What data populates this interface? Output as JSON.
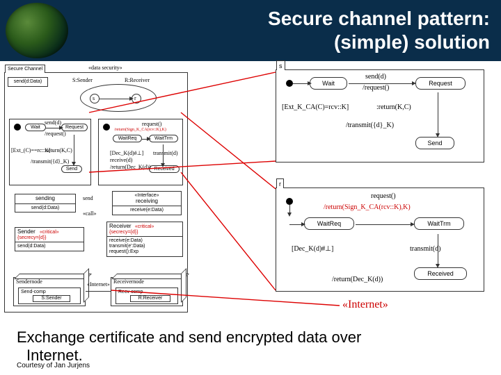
{
  "header": {
    "title_line1": "Secure channel pattern:",
    "title_line2": "(simple) solution"
  },
  "left": {
    "panel_tab": "Secure Channel",
    "stereotype_ds": "«data security»",
    "iface_send_title": "send(d:Data)",
    "actor_s": "S:Sender",
    "actor_r": "R:Receiver",
    "state": {
      "wait": "Wait",
      "request": "Request",
      "send": "Send",
      "ev_send": "send(d)",
      "ev_req": "/request()",
      "ev_ext": "[Ext_(C)==rc::K]",
      "ev_ret": ":return(K,C)",
      "ev_trans": "/transmit({d}_K)"
    },
    "iface_sending": {
      "title": "sending",
      "row": "send(d:Data)"
    },
    "iface_receiving": {
      "title": "receiving",
      "stereo": "«Interface»",
      "row": "receive(e:Data)"
    },
    "sender_box": {
      "name": "Sender",
      "stereo": "«critical»",
      "secrecy": "{secrecy={d}}",
      "row": "send(d:Data)"
    },
    "receiver_box": {
      "name": "Receiver",
      "stereo": "«critical»",
      "secrecy": "{secrecy={d}}",
      "rows": [
        "receive(e:Data)",
        "transmit(e':Data)",
        "request():Exp"
      ]
    },
    "assoc_send": "send",
    "assoc_call": "«call»",
    "deploy": {
      "sendnode": "Sendernode",
      "sendcomp": "Send-comp",
      "ssender": "S:Sender",
      "recvnode": "Receivernode",
      "recvcomp": "Recv-comp",
      "rreceiver": "R:Receiver",
      "link": "«Internet»"
    }
  },
  "mid": {
    "waitreq": "WaitReq",
    "waittrm": "WaitTrm",
    "received": "Received",
    "ev_req": "request()",
    "ev_retsign": "/return(Sign_K_CA(rcv::K),K)",
    "ev_dec": "[Dec_K(d)#⊥]",
    "ev_recv": "receive(d)",
    "ev_retdec": "/return(Dec_K(d))",
    "ev_transmit": "transmit(d)"
  },
  "rightS": {
    "tab": "s",
    "wait": "Wait",
    "request": "Request",
    "send": "Send",
    "ev_send": "send(d)",
    "ev_req": "/request()",
    "ev_ext": "[Ext_K_CA(C)=rcv::K]",
    "ev_ret": ":return(K,C)",
    "ev_trans": "/transmit({d}_K)"
  },
  "rightR": {
    "tab": "r",
    "waitreq": "WaitReq",
    "waittrm": "WaitTrm",
    "received": "Received",
    "ev_req": "request()",
    "ev_retsign": "/return(Sign_K_CA(rcv::K),K)",
    "ev_dec": "[Dec_K(d)#⊥]",
    "ev_trans": "transmit(d)",
    "ev_retdec": "/return(Dec_K(d))"
  },
  "internet_label": "«Internet»",
  "footer": {
    "line1": "Exchange certificate and send encrypted data over",
    "line2": "Internet.",
    "courtesy": "Courtesy of Jan Jurjens"
  }
}
